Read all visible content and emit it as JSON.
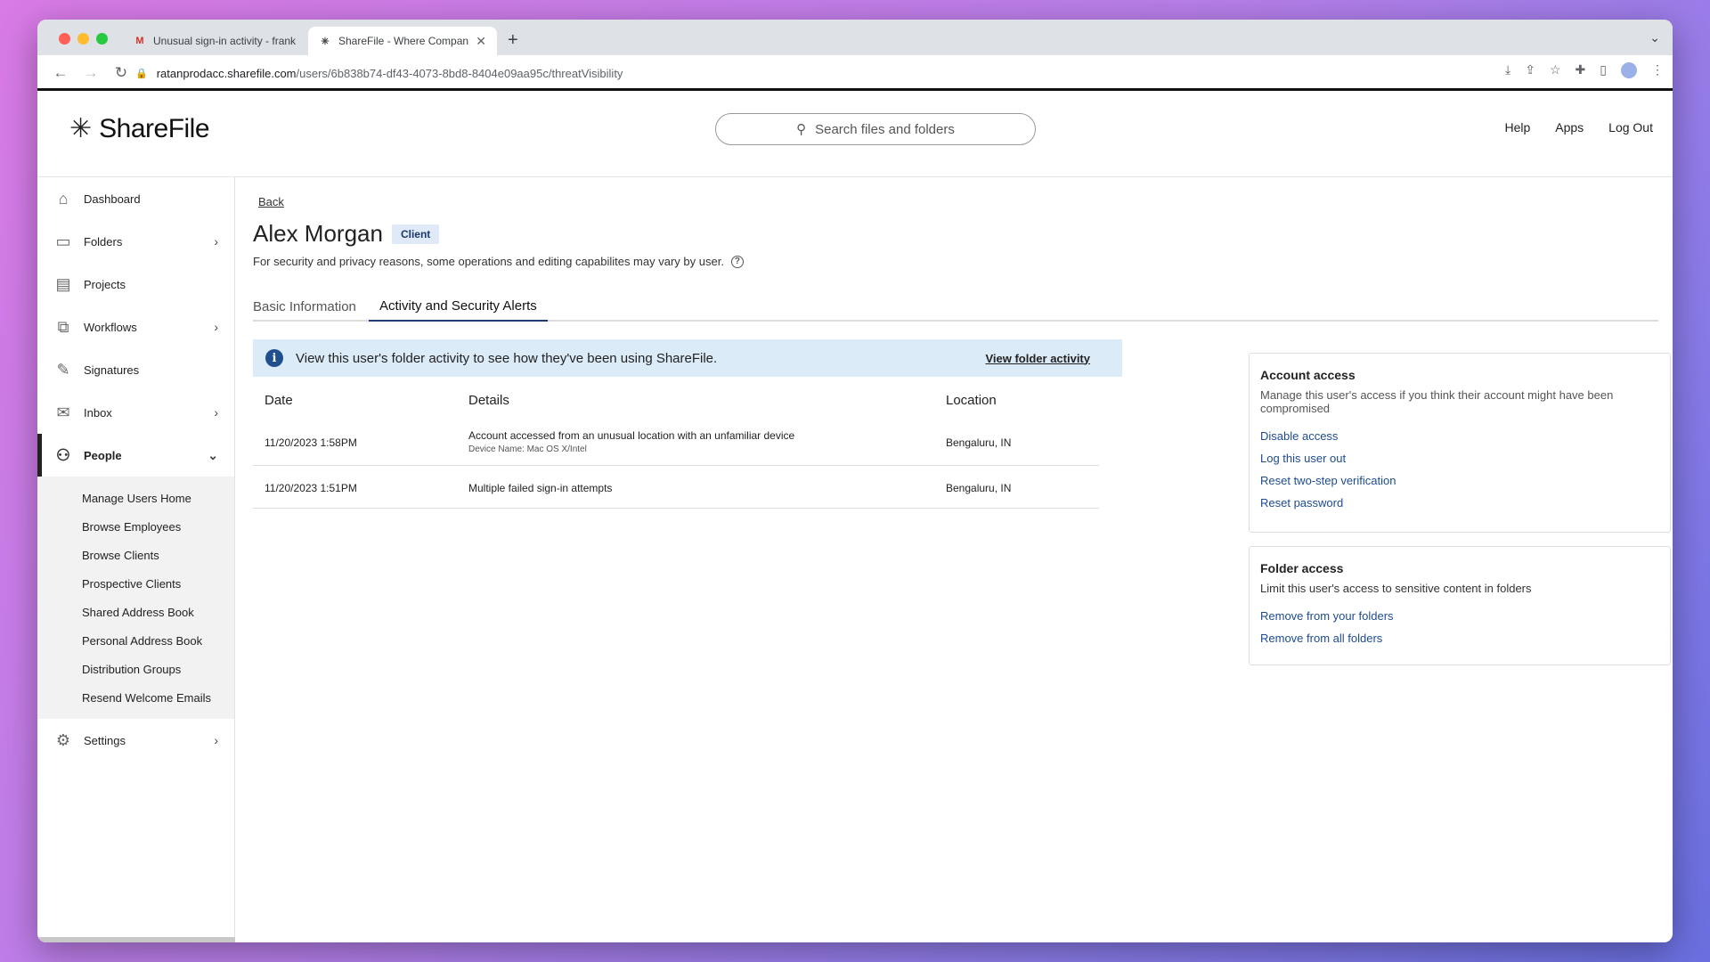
{
  "browser": {
    "tabs": [
      {
        "title": "Unusual sign-in activity - frank",
        "favicon": "gmail-icon",
        "active": false
      },
      {
        "title": "ShareFile - Where Companies",
        "favicon": "sharefile-icon",
        "active": true
      }
    ],
    "url_host": "ratanprodacc.sharefile.com",
    "url_path": "/users/6b838b74-df43-4073-8bd8-8404e09aa95c/threatVisibility"
  },
  "header": {
    "logo_text": "ShareFile",
    "search_placeholder": "Search files and folders",
    "links": [
      "Help",
      "Apps",
      "Log Out"
    ]
  },
  "sidebar": {
    "items": [
      {
        "label": "Dashboard",
        "icon": "home-icon",
        "chevron": false
      },
      {
        "label": "Folders",
        "icon": "folder-icon",
        "chevron": true
      },
      {
        "label": "Projects",
        "icon": "projects-icon",
        "chevron": false
      },
      {
        "label": "Workflows",
        "icon": "workflows-icon",
        "chevron": true
      },
      {
        "label": "Signatures",
        "icon": "pen-icon",
        "chevron": false
      },
      {
        "label": "Inbox",
        "icon": "mail-icon",
        "chevron": true
      },
      {
        "label": "People",
        "icon": "people-icon",
        "chevron": true,
        "expanded": true
      },
      {
        "label": "Settings",
        "icon": "gear-icon",
        "chevron": true
      }
    ],
    "people_sub": [
      "Manage Users Home",
      "Browse Employees",
      "Browse Clients",
      "Prospective Clients",
      "Shared Address Book",
      "Personal Address Book",
      "Distribution Groups",
      "Resend Welcome Emails"
    ]
  },
  "main": {
    "back": "Back",
    "user_name": "Alex Morgan",
    "user_badge": "Client",
    "disclaimer": "For security and privacy reasons, some operations and editing capabilites may vary by user.",
    "tabs": [
      "Basic Information",
      "Activity and Security Alerts"
    ],
    "active_tab": "Activity and Security Alerts",
    "banner": {
      "text": "View this user's folder activity to see how they've been using ShareFile.",
      "link": "View folder activity"
    },
    "table": {
      "headers": [
        "Date",
        "Details",
        "Location"
      ],
      "rows": [
        {
          "date": "11/20/2023 1:58PM",
          "details": "Account accessed from an unusual location with an unfamiliar device",
          "sub": "Device Name: Mac OS X/Intel",
          "location": "Bengaluru, IN"
        },
        {
          "date": "11/20/2023 1:51PM",
          "details": "Multiple failed sign-in attempts",
          "sub": "",
          "location": "Bengaluru, IN"
        }
      ]
    },
    "account_access": {
      "title": "Account access",
      "desc": "Manage this user's access if you think their account might have been compromised",
      "links": [
        "Disable access",
        "Log this user out",
        "Reset two-step verification",
        "Reset password"
      ]
    },
    "folder_access": {
      "title": "Folder access",
      "desc": "Limit this user's access to sensitive content in folders",
      "links": [
        "Remove from your folders",
        "Remove from all folders"
      ]
    }
  }
}
